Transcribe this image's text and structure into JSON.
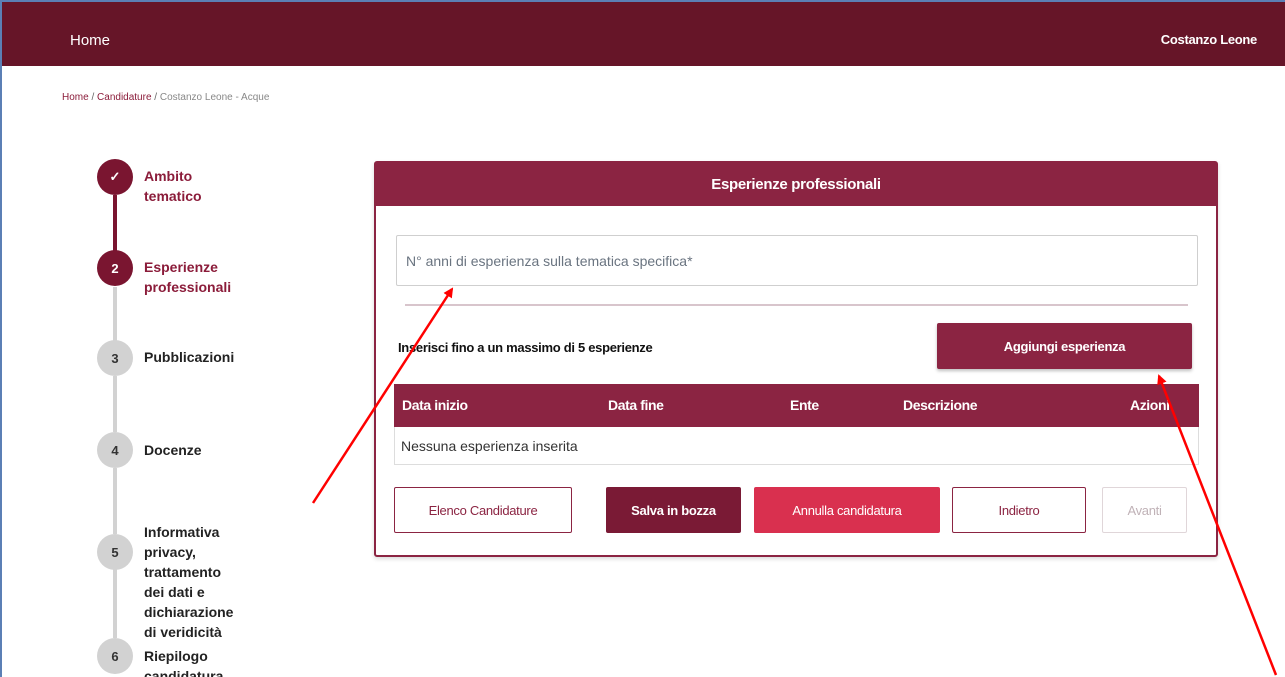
{
  "topbar": {
    "home_label": "Home",
    "user_name": "Costanzo Leone"
  },
  "breadcrumb": {
    "home": "Home",
    "sep1": " / ",
    "candidature": "Candidature",
    "sep2": " / ",
    "current": "Costanzo Leone - Acque"
  },
  "steps": [
    {
      "number": "✓",
      "label": "Ambito tematico",
      "state": "active"
    },
    {
      "number": "2",
      "label": "Esperienze professionali",
      "state": "active"
    },
    {
      "number": "3",
      "label": "Pubblicazioni",
      "state": "inactive"
    },
    {
      "number": "4",
      "label": "Docenze",
      "state": "inactive"
    },
    {
      "number": "5",
      "label_lines": [
        "Informativa privacy,",
        "trattamento dei dati e",
        "dichiarazione di veridicità"
      ],
      "state": "inactive"
    },
    {
      "number": "6",
      "label": "Riepilogo candidatura",
      "state": "inactive"
    }
  ],
  "card": {
    "title": "Esperienze professionali",
    "years_input": {
      "placeholder": "N° anni di esperienza sulla tematica specifica*",
      "value": ""
    },
    "hint": "Inserisci fino a un massimo di 5 esperienze",
    "add_button": "Aggiungi esperienza",
    "table": {
      "columns": [
        "Data inizio",
        "Data fine",
        "Ente",
        "Descrizione",
        "Azioni"
      ],
      "empty_message": "Nessuna esperienza inserita"
    },
    "actions": {
      "list": "Elenco Candidature",
      "save_draft": "Salva in bozza",
      "cancel": "Annulla candidatura",
      "back": "Indietro",
      "next": "Avanti"
    }
  },
  "colors": {
    "brand": "#661528",
    "accent": "#8b2442",
    "danger": "#d9304f",
    "annotation": "#ff0000"
  }
}
